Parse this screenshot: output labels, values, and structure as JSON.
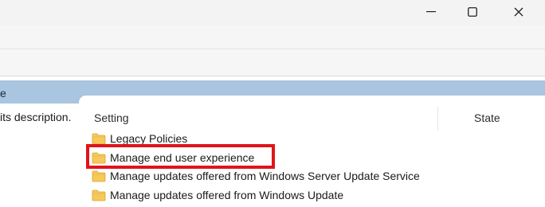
{
  "window": {
    "controls": [
      "minimize-icon",
      "maximize-icon",
      "close-icon"
    ]
  },
  "left_pane": {
    "header_fragment": "e",
    "description_fragment": "its description."
  },
  "table": {
    "columns": {
      "setting": "Setting",
      "state": "State"
    },
    "rows": [
      {
        "label": "Legacy Policies",
        "icon": "folder-icon"
      },
      {
        "label": "Manage end user experience",
        "icon": "folder-icon"
      },
      {
        "label": "Manage updates offered from Windows Server Update Service",
        "icon": "folder-icon"
      },
      {
        "label": "Manage updates offered from Windows Update",
        "icon": "folder-icon"
      }
    ]
  },
  "colors": {
    "header_strip": "#a9c5df",
    "highlight_box": "#e0141a",
    "folder": "#f6c95a"
  }
}
